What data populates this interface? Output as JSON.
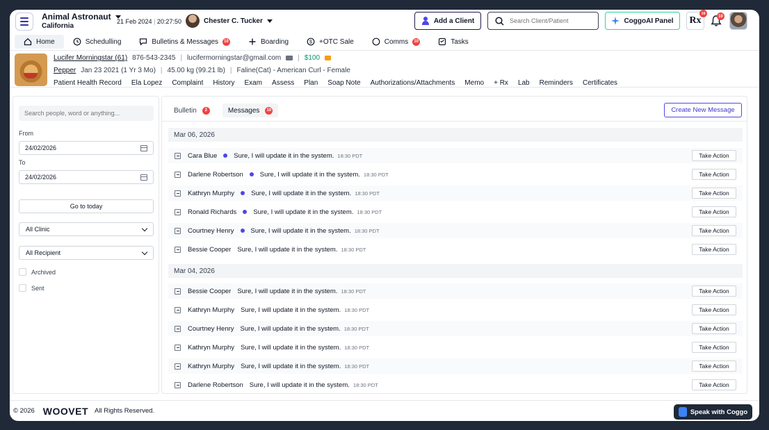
{
  "header": {
    "clinic_name": "Animal Astronaut",
    "clinic_location": "California",
    "date": "21 Feb 2024",
    "time": "20:27:50",
    "user_name": "Chester C. Tucker",
    "add_client_label": "Add a Client",
    "search_placeholder": "Search Client/Patient",
    "coggo_panel_label": "CoggoAI Panel",
    "rx_label": "Rx",
    "rx_badge": "10",
    "bell_badge": "10"
  },
  "nav": [
    {
      "label": "Home",
      "icon": "home-icon",
      "active": true
    },
    {
      "label": "Schedulling",
      "icon": "clock-icon"
    },
    {
      "label": "Bulletins & Messages",
      "icon": "chat-icon",
      "badge": "10"
    },
    {
      "label": "Boarding",
      "icon": "plus-icon"
    },
    {
      "label": "+OTC Sale",
      "icon": "dollar-icon"
    },
    {
      "label": "Comms",
      "icon": "message-icon",
      "badge": "10"
    },
    {
      "label": "Tasks",
      "icon": "tasks-icon"
    }
  ],
  "patient": {
    "owner_name": "Lucifer Morningstar (61)",
    "phone": "876-543-2345",
    "email": "lucifermorningstar@gmail.com",
    "balance": "$100",
    "pet_name": "Pepper",
    "dob": "Jan 23 2021 (1 Yr 3 Mo)",
    "weight": "45.00 kg (99.21 lb)",
    "breed": "Faline(Cat) - American Curl - Female",
    "links": [
      "Patient Health Record",
      "Ela Lopez",
      "Complaint",
      "History",
      "Exam",
      "Assess",
      "Plan",
      "Soap Note",
      "Authorizations/Attachments",
      "Memo",
      "+ Rx",
      "Lab",
      "Reminders",
      "Certificates"
    ]
  },
  "filters": {
    "search_placeholder": "Search people, word or anything...",
    "from_label": "From",
    "from_value": "24/02/2026",
    "to_label": "To",
    "to_value": "24/02/2026",
    "today_label": "Go to today",
    "clinic_select": "All Clinic",
    "recipient_select": "All Recipient",
    "archived_label": "Archived",
    "sent_label": "Sent"
  },
  "messages_panel": {
    "tab_bulletin": "Bulletin",
    "tab_bulletin_badge": "2",
    "tab_messages": "Messages",
    "tab_messages_badge": "10",
    "create_label": "Create New Message",
    "action_label": "Take Action",
    "groups": [
      {
        "date": "Mar 06, 2026",
        "rows": [
          {
            "sender": "Cara Blue",
            "unread": true,
            "text": "Sure, I will update it in the system.",
            "time": "18:30 PDT"
          },
          {
            "sender": "Darlene Robertson",
            "unread": true,
            "text": "Sure, I will update it in the system.",
            "time": "18:30 PDT"
          },
          {
            "sender": "Kathryn Murphy",
            "unread": true,
            "text": "Sure, I will update it in the system.",
            "time": "18:30 PDT"
          },
          {
            "sender": "Ronald Richards",
            "unread": true,
            "text": "Sure, I will update it in the system.",
            "time": "18:30 PDT"
          },
          {
            "sender": "Courtney Henry",
            "unread": true,
            "text": "Sure, I will update it in the system.",
            "time": "18:30 PDT"
          },
          {
            "sender": "Bessie Cooper",
            "unread": false,
            "text": "Sure, I will update it in the system.",
            "time": "18:30 PDT"
          }
        ]
      },
      {
        "date": "Mar 04, 2026",
        "rows": [
          {
            "sender": "Bessie Cooper",
            "unread": false,
            "text": "Sure, I will update it in the system.",
            "time": "18:30 PDT"
          },
          {
            "sender": "Kathryn Murphy",
            "unread": false,
            "text": "Sure, I will update it in the system.",
            "time": "18:30 PDT"
          },
          {
            "sender": "Courtney Henry",
            "unread": false,
            "text": "Sure, I will update it in the system.",
            "time": "18:30 PDT"
          },
          {
            "sender": "Kathryn Murphy",
            "unread": false,
            "text": "Sure, I will update it in the system.",
            "time": "18:30 PDT"
          },
          {
            "sender": "Kathryn Murphy",
            "unread": false,
            "text": "Sure, I will update it in the system.",
            "time": "18:30 PDT"
          },
          {
            "sender": "Darlene Robertson",
            "unread": false,
            "text": "Sure, I will update it in the system.",
            "time": "18:30 PDT"
          }
        ]
      }
    ]
  },
  "footer": {
    "copyright": "© 2026",
    "logo_text": "WOOVET",
    "rights": "All Rights Reserved.",
    "speak_label": "Speak with Coggo"
  },
  "colors": {
    "accent": "#4f46e5",
    "badge": "#ef4444",
    "balance": "#059669",
    "coggo_border": "#34d399"
  }
}
